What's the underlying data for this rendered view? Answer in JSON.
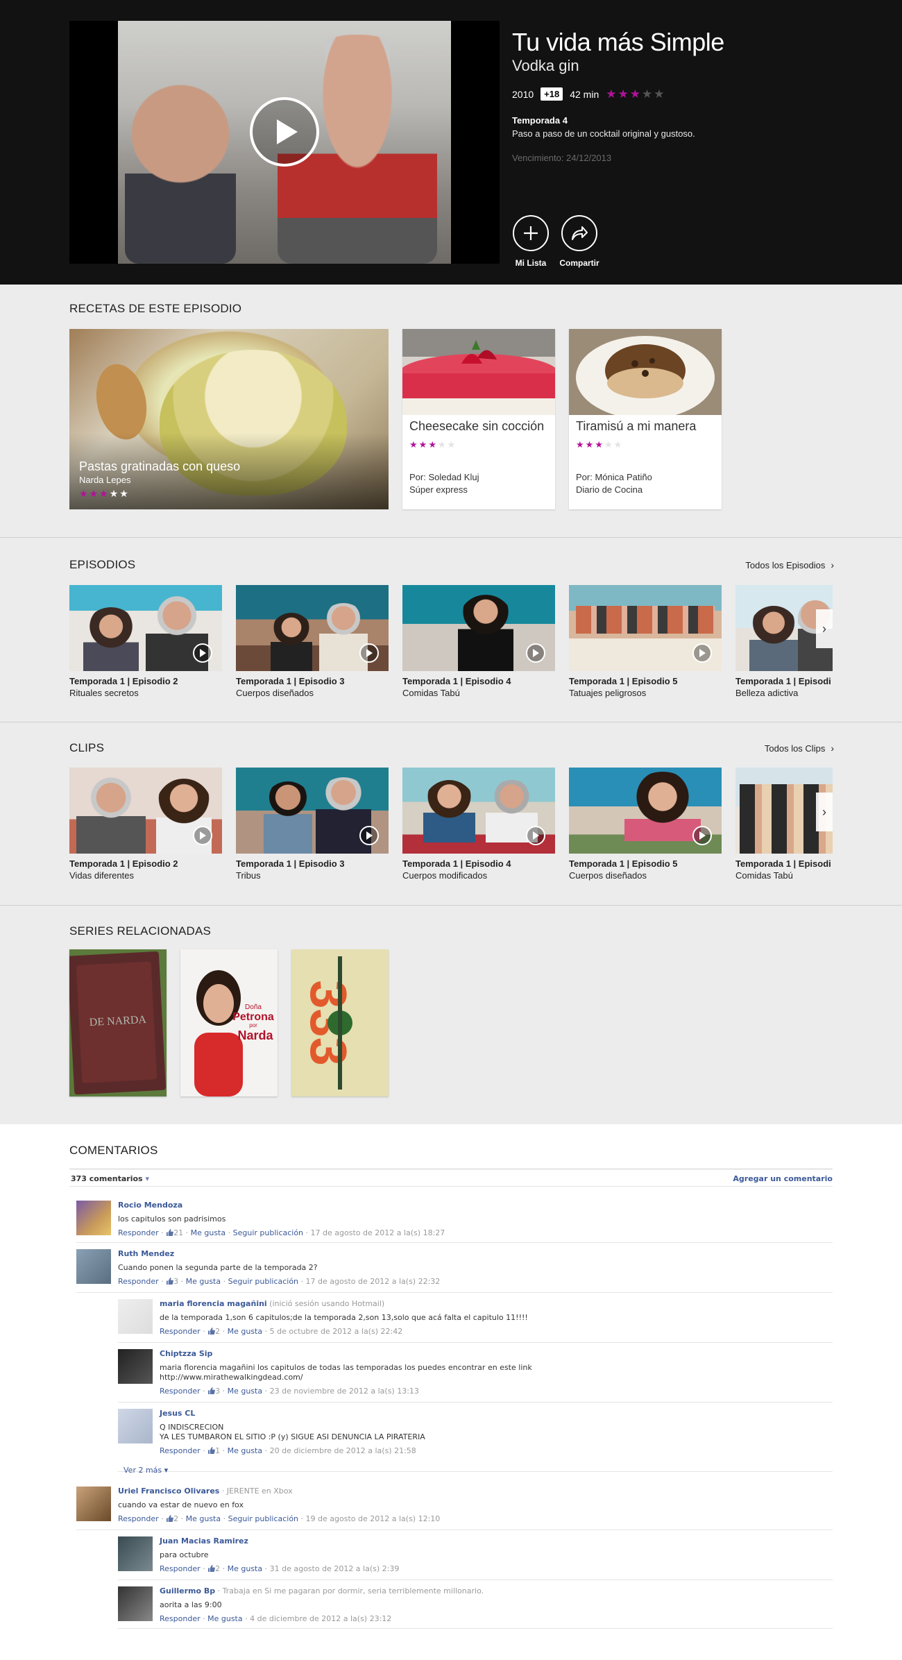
{
  "hero": {
    "title": "Tu vida más Simple",
    "subtitle": "Vodka gin",
    "year": "2010",
    "age_rating": "+18",
    "duration": "42 min",
    "rating": 3,
    "season": "Temporada 4",
    "description": "Paso a paso de un cocktail original y gustoso.",
    "expiry": "Vencimiento: 24/12/2013",
    "my_list_label": "Mi Lista",
    "share_label": "Compartir"
  },
  "recipes": {
    "section_title": "RECETAS DE ESTE EPISODIO",
    "featured": {
      "title": "Pastas gratinadas con queso",
      "author": "Narda Lepes",
      "rating": 3
    },
    "cards": [
      {
        "title": "Cheesecake sin cocción",
        "rating": 3,
        "by": "Por: Soledad Kluj",
        "category": "Súper express"
      },
      {
        "title": "Tiramisú a mi manera",
        "rating": 3,
        "by": "Por: Mónica Patiño",
        "category": "Diario de Cocina"
      }
    ]
  },
  "episodes": {
    "section_title": "EPISODIOS",
    "see_all": "Todos los Episodios",
    "items": [
      {
        "label": "Temporada 1 | Episodio 2",
        "name": "Rituales secretos"
      },
      {
        "label": "Temporada 1 | Episodio 3",
        "name": "Cuerpos diseñados"
      },
      {
        "label": "Temporada 1 | Episodio 4",
        "name": "Comidas Tabú"
      },
      {
        "label": "Temporada 1 | Episodio 5",
        "name": "Tatuajes peligrosos"
      },
      {
        "label": "Temporada 1 | Episodi",
        "name": "Belleza adictiva"
      }
    ]
  },
  "clips": {
    "section_title": "CLIPS",
    "see_all": "Todos los Clips",
    "items": [
      {
        "label": "Temporada 1 | Episodio 2",
        "name": "Vidas diferentes"
      },
      {
        "label": "Temporada 1 | Episodio 3",
        "name": "Tribus"
      },
      {
        "label": "Temporada 1 | Episodio 4",
        "name": "Cuerpos modificados"
      },
      {
        "label": "Temporada 1 | Episodio 5",
        "name": "Cuerpos diseñados"
      },
      {
        "label": "Temporada 1 | Episodi",
        "name": "Comidas Tabú"
      }
    ]
  },
  "related": {
    "section_title": "SERIES RELACIONADAS",
    "items": [
      {
        "text": "DE NARDA"
      },
      {
        "text_top": "Doña",
        "text_main": "Petrona",
        "text_by": "por",
        "text_name": "Narda"
      },
      {
        "text": "333"
      }
    ]
  },
  "comments": {
    "section_title": "COMENTARIOS",
    "count_label": "373 comentarios",
    "add_label": "Agregar un comentario",
    "see_more": "Ver 2 más",
    "reply": "Responder",
    "like": "Me gusta",
    "follow": "Seguir publicación",
    "items": [
      {
        "name": "Rocio Mendoza",
        "extra": "",
        "lines": [
          "los capitulos son padrisimos"
        ],
        "likes": "21",
        "follow": true,
        "date": "17 de agosto de 2012 a la(s) 18:27"
      },
      {
        "name": "Ruth Mendez",
        "extra": "",
        "lines": [
          "Cuando ponen la segunda parte de la temporada 2?"
        ],
        "likes": "3",
        "follow": true,
        "date": "17 de agosto de 2012 a la(s) 22:32"
      },
      {
        "name": "maria florencia magañini",
        "extra": "(inició sesión usando Hotmail)",
        "lines": [
          "de la temporada 1,son 6 capitulos;de la temporada 2,son 13,solo que acá falta el capitulo 11!!!!"
        ],
        "likes": "2",
        "follow": false,
        "date": "5 de octubre de 2012 a la(s) 22:42"
      },
      {
        "name": "Chiptzza Sip",
        "extra": "",
        "lines": [
          "maria florencia magañini los capitulos de todas las temporadas los puedes encontrar en este link",
          "http://www.mirathewalkingdead.com/"
        ],
        "likes": "3",
        "follow": false,
        "date": "23 de noviembre de 2012 a la(s) 13:13"
      },
      {
        "name": "Jesus CL",
        "extra": "",
        "lines": [
          "Q INDISCRECION",
          "YA LES TUMBARON EL SITIO :P (y) SIGUE ASI DENUNCIA LA PIRATERIA"
        ],
        "likes": "1",
        "follow": false,
        "date": "20 de diciembre de 2012 a la(s) 21:58"
      },
      {
        "name": "Uriel Francisco Olivares",
        "extra": "· JERENTE en Xbox",
        "lines": [
          "cuando va estar de nuevo en fox"
        ],
        "likes": "2",
        "follow": true,
        "date": "19 de agosto de 2012 a la(s) 12:10"
      },
      {
        "name": "Juan Macias Ramirez",
        "extra": "",
        "lines": [
          "para octubre"
        ],
        "likes": "2",
        "follow": false,
        "date": "31 de agosto de 2012 a la(s) 2:39"
      },
      {
        "name": "Guillermo Bp",
        "extra": "· Trabaja en Si me pagaran por dormir, seria terriblemente millonario.",
        "lines": [
          "aorita a las 9:00"
        ],
        "likes": "",
        "follow": false,
        "date": "4 de diciembre de 2012 a la(s) 23:12"
      }
    ]
  },
  "colors": {
    "accent": "#b0129a",
    "hero_bg": "#121212",
    "link": "#3b5998",
    "page_bg": "#ececec"
  },
  "icons": {
    "play": "play-icon",
    "plus": "plus-icon",
    "share": "share-icon",
    "chevron": "chevron-right-icon",
    "like": "thumbs-up-icon"
  }
}
